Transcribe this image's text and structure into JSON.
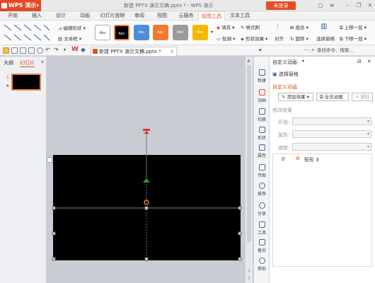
{
  "app": {
    "name": "WPS 演示",
    "window_title": "新建 PPTX 演示文稿.pptx * - WPS 演示",
    "login_label": "未登录"
  },
  "tabs": [
    "开始",
    "插入",
    "设计",
    "动画",
    "幻灯片放映",
    "审阅",
    "视图",
    "云服务",
    "绘图工具",
    "文本工具"
  ],
  "active_tab": "绘图工具",
  "ribbon": {
    "edit_shape": "编辑形状",
    "text_box": "文本框",
    "style_label": "Abc",
    "fill": "填充",
    "outline": "轮廓",
    "format_brush": "格式刷",
    "shape_effect": "形状效果",
    "align": "对齐",
    "group": "组合",
    "rotate": "旋转",
    "selection_pane": "选择窗格",
    "bring_forward": "上移一层",
    "send_backward": "下移一层"
  },
  "doc_tab": "新建 PPTX 演示文稿.pptx *",
  "search_cmd": "查找命令、搜索...",
  "left_panel": {
    "tab_outline": "大纲",
    "tab_slides": "幻灯片",
    "slide_number": "1"
  },
  "sidebar": [
    "新建",
    "动画",
    "切换",
    "形状",
    "属性",
    "传图",
    "推荐",
    "分享",
    "工具",
    "备份",
    "帮助"
  ],
  "task_pane": {
    "title": "自定义动画",
    "selection_pane": "选择窗格",
    "section_title": "自定义动画",
    "add_effect": "添加效果",
    "all_animation": "全文动画",
    "delete": "删除",
    "modify_label": "修改效果",
    "start_label": "开始:",
    "property_label": "属性:",
    "speed_label": "速度:",
    "item_index": "0",
    "item_name": "矩形 3"
  },
  "colors": {
    "accent": "#e44c26",
    "active_tab_text": "#d9531e",
    "slide_bg": "#000000"
  }
}
